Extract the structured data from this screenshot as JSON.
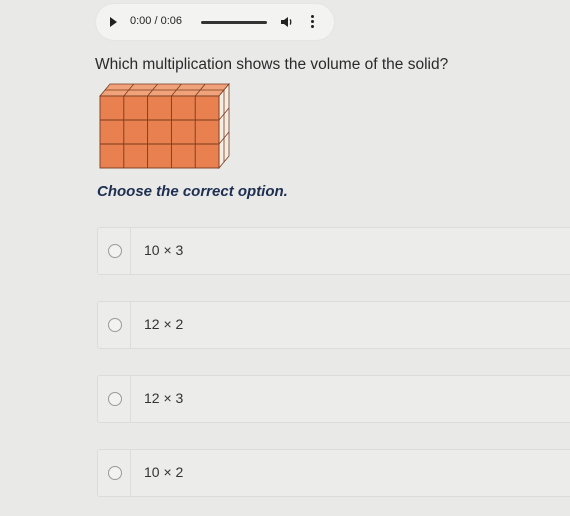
{
  "player": {
    "time": "0:00 / 0:06",
    "icons": [
      "play-icon",
      "volume-icon",
      "more-vert-icon"
    ]
  },
  "question": "Which multiplication shows the volume of the solid?",
  "instruction": "Choose the correct option.",
  "options": [
    {
      "label": "10 × 3"
    },
    {
      "label": "12 × 2"
    },
    {
      "label": "12 × 3"
    },
    {
      "label": "10 × 2"
    }
  ],
  "colors": {
    "cube_face": "#e8814f",
    "cube_top": "#f0a37a",
    "cube_side": "#f4ede4",
    "cube_edge": "#7a3a1e",
    "instruction": "#1e2f52"
  }
}
